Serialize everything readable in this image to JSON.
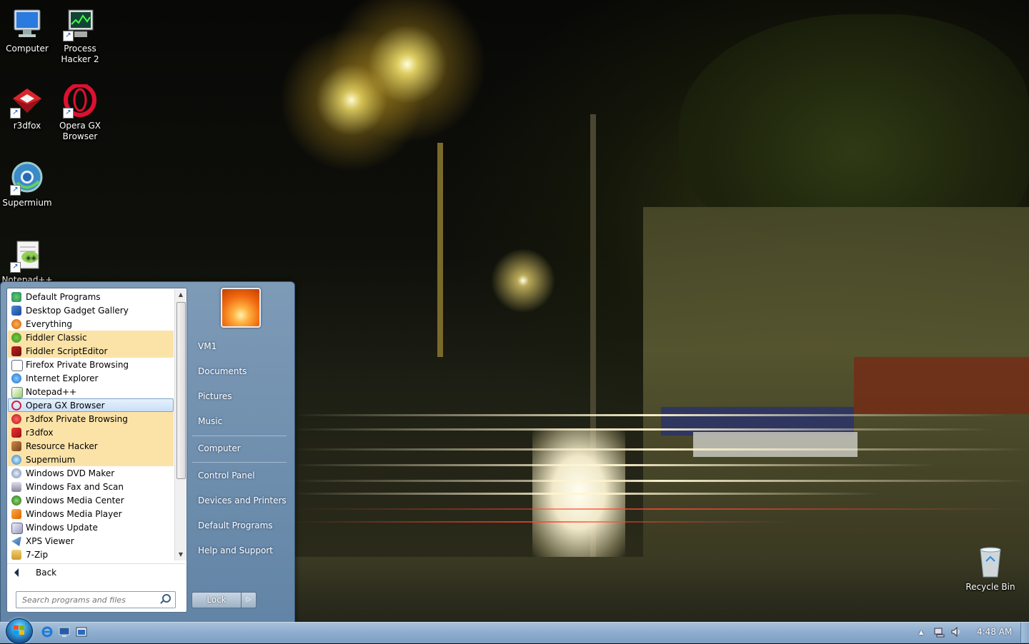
{
  "desktop": {
    "icons": [
      {
        "label": "Computer"
      },
      {
        "label": "Process Hacker 2"
      },
      {
        "label": "r3dfox"
      },
      {
        "label": "Opera GX Browser"
      },
      {
        "label": "Supermium"
      },
      {
        "label": "Notepad++"
      },
      {
        "label": "Recycle Bin"
      }
    ]
  },
  "start_menu": {
    "programs": [
      {
        "label": "Default Programs"
      },
      {
        "label": "Desktop Gadget Gallery"
      },
      {
        "label": "Everything"
      },
      {
        "label": "Fiddler Classic"
      },
      {
        "label": "Fiddler ScriptEditor"
      },
      {
        "label": "Firefox Private Browsing"
      },
      {
        "label": "Internet Explorer"
      },
      {
        "label": "Notepad++"
      },
      {
        "label": "Opera GX Browser"
      },
      {
        "label": "r3dfox Private Browsing"
      },
      {
        "label": "r3dfox"
      },
      {
        "label": "Resource Hacker"
      },
      {
        "label": "Supermium"
      },
      {
        "label": "Windows DVD Maker"
      },
      {
        "label": "Windows Fax and Scan"
      },
      {
        "label": "Windows Media Center"
      },
      {
        "label": "Windows Media Player"
      },
      {
        "label": "Windows Update"
      },
      {
        "label": "XPS Viewer"
      },
      {
        "label": "7-Zip"
      }
    ],
    "back_label": "Back",
    "search_placeholder": "Search programs and files",
    "right_items": [
      {
        "label": "VM1"
      },
      {
        "label": "Documents"
      },
      {
        "label": "Pictures"
      },
      {
        "label": "Music"
      },
      {
        "label": "Computer"
      },
      {
        "label": "Control Panel"
      },
      {
        "label": "Devices and Printers"
      },
      {
        "label": "Default Programs"
      },
      {
        "label": "Help and Support"
      }
    ],
    "lock_label": "Lock",
    "lock_arrow": "▷"
  },
  "taskbar": {
    "clock": "4:48 AM",
    "tray_up_arrow": "▲"
  },
  "colors": {
    "highlight_new": "#fbe3a8",
    "selected_item": "#c9e0f8",
    "taskbar": "#8faecf"
  }
}
